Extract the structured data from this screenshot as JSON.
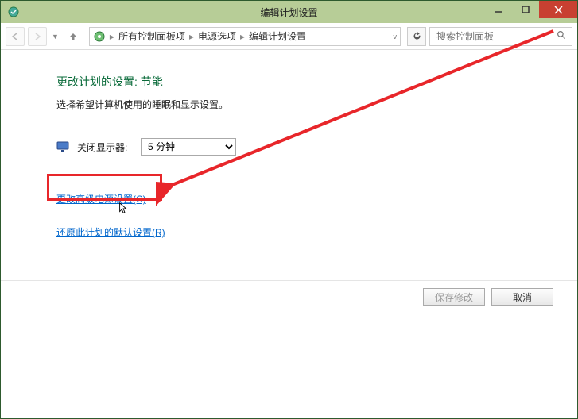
{
  "window": {
    "title": "编辑计划设置"
  },
  "nav": {
    "path": [
      "所有控制面板项",
      "电源选项",
      "编辑计划设置"
    ],
    "search_placeholder": "搜索控制面板"
  },
  "page": {
    "heading": "更改计划的设置: 节能",
    "subtitle": "选择希望计算机使用的睡眠和显示设置。",
    "display_off_label": "关闭显示器:",
    "display_off_value": "5 分钟",
    "link_advanced": "更改高级电源设置(C)",
    "link_restore": "还原此计划的默认设置(R)"
  },
  "footer": {
    "save": "保存修改",
    "cancel": "取消"
  }
}
